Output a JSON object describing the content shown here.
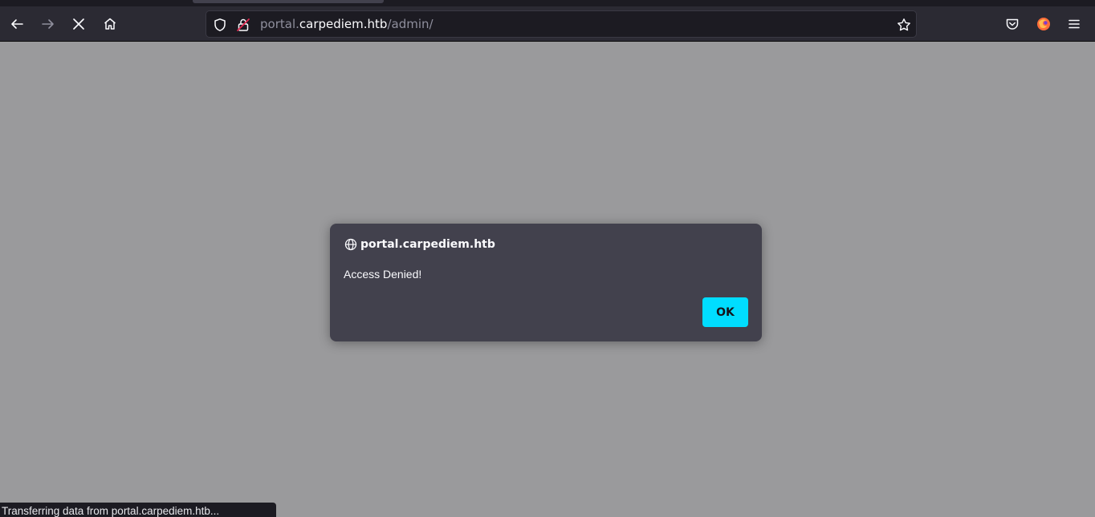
{
  "toolbar": {
    "icons": {
      "back": "arrow-left-icon",
      "forward": "arrow-right-icon",
      "stop": "close-icon",
      "home": "home-icon",
      "bookmark": "star-icon",
      "pocket": "pocket-icon",
      "account": "firefox-account-icon",
      "menu": "hamburger-menu-icon"
    },
    "url": {
      "prefix": "portal.",
      "host": "carpediem.htb",
      "path": "/admin/"
    }
  },
  "dialog": {
    "origin": "portal.carpediem.htb",
    "message": "Access Denied!",
    "ok_label": "OK",
    "accent_color": "#00ddff"
  },
  "status_bar": {
    "text": "Transferring data from portal.carpediem.htb..."
  },
  "colors": {
    "toolbar_bg": "#2b2a33",
    "page_bg": "#9a9a9c",
    "dialog_bg": "#42414d"
  }
}
